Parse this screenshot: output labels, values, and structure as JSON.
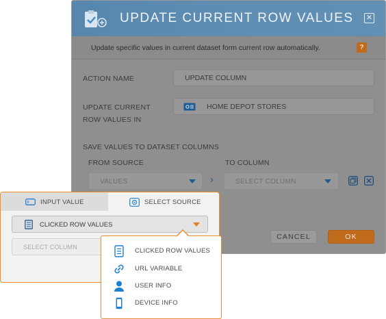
{
  "dialog": {
    "title": "UPDATE CURRENT ROW VALUES",
    "subtitle": "Update specific values in current dataset form current row automatically.",
    "help": "?",
    "close": "✕",
    "action_name": {
      "label": "ACTION NAME",
      "value": "UPDATE COLUMN"
    },
    "update_in": {
      "label_line1": "UPDATE CURRENT",
      "label_line2": "ROW VALUES IN",
      "value": "HOME DEPOT STORES"
    },
    "save_values": {
      "section_label": "SAVE VALUES TO DATASET COLUMNS",
      "from_label": "FROM SOURCE",
      "to_label": "TO COLUMN",
      "from_value": "VALUES",
      "arrow": "›",
      "to_placeholder": "SELECT COLUMN"
    },
    "buttons": {
      "cancel": "CANCEL",
      "ok": "OK"
    }
  },
  "source_panel": {
    "tabs": [
      {
        "label": "INPUT VALUE",
        "icon": "input-icon",
        "active": false
      },
      {
        "label": "SELECT SOURCE",
        "icon": "source-icon",
        "active": true
      }
    ],
    "selected_source": "CLICKED ROW VALUES",
    "column_placeholder": "SELECT COLUMN"
  },
  "menu": {
    "items": [
      {
        "label": "CLICKED ROW VALUES",
        "icon": "document-icon"
      },
      {
        "label": "URL VARIABLE",
        "icon": "link-icon"
      },
      {
        "label": "USER INFO",
        "icon": "user-icon"
      },
      {
        "label": "DEVICE INFO",
        "icon": "device-icon"
      }
    ]
  },
  "colors": {
    "header_blue": "#3b8fd2",
    "accent_orange": "#ef8a2a",
    "icon_blue": "#1f7fd1",
    "overlay_grey": "#8f8f8f"
  }
}
